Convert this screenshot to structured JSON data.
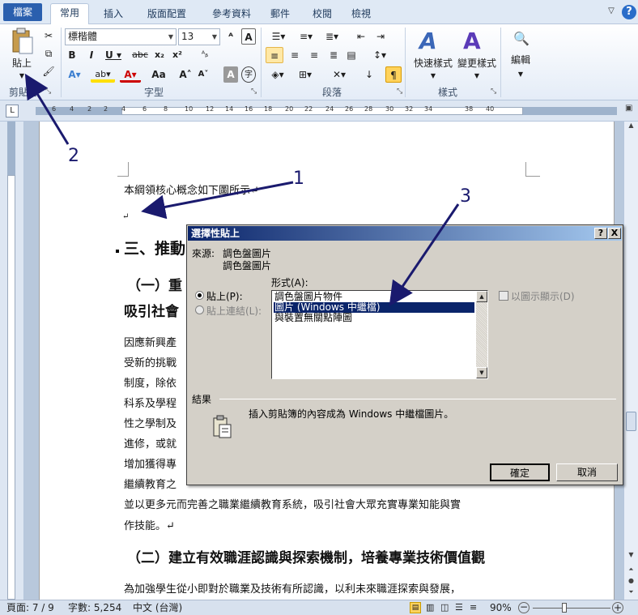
{
  "tabs": [
    {
      "label": "檔案"
    },
    {
      "label": "常用"
    },
    {
      "label": "插入"
    },
    {
      "label": "版面配置"
    },
    {
      "label": "參考資料"
    },
    {
      "label": "郵件"
    },
    {
      "label": "校閱"
    },
    {
      "label": "檢視"
    }
  ],
  "ribbon": {
    "paste_label": "貼上",
    "clipboard_label": "剪貼簿",
    "font_name": "標楷體",
    "font_size": "13",
    "font_group_label": "字型",
    "paragraph_label": "段落",
    "quick_styles_label": "快速樣式",
    "change_styles_label": "變更樣式",
    "styles_group_label": "樣式",
    "editing_label": "編輯"
  },
  "ruler": {
    "ticks": [
      "6",
      "4",
      "2",
      "2",
      "4",
      "6",
      "8",
      "10",
      "12",
      "14",
      "16",
      "18",
      "20",
      "22",
      "24",
      "26",
      "28",
      "30",
      "32",
      "34",
      "38",
      "40"
    ]
  },
  "document": {
    "line1": "本綱領核心概念如下圖所示↵",
    "line2": "↵",
    "h3": "三、推動",
    "h4a": "（一）重",
    "h4a2": "吸引社會",
    "p_lines": [
      "因應新興產",
      "受新的挑戰",
      "制度，除依",
      "科系及學程",
      "性之學制及",
      "進修，或就",
      "增加獲得專",
      "繼續教育之"
    ],
    "p_full1": "並以更多元而完善之職業繼續教育系統，吸引社會大眾充實專業知能與實",
    "p_full2": "作技能。↵",
    "h4b": "（二）建立有效職涯認識與探索機制，培養專業技術價值觀",
    "p_last": "為加強學生從小即對於職業及技術有所認識，以利未來職涯探索與發展，"
  },
  "dialog": {
    "title": "選擇性貼上",
    "help": "?",
    "close": "X",
    "source_label": "來源:",
    "source_value1": "調色盤圖片",
    "source_value2": "調色盤圖片",
    "as_label": "形式(A):",
    "paste_option": "貼上(P):",
    "paste_link_option": "貼上連結(L):",
    "list_items": [
      "調色盤圖片物件",
      "圖片 (Windows 中繼檔)",
      "與裝置無關點陣圖"
    ],
    "display_icon_label": "以圖示顯示(D)",
    "result_label": "結果",
    "result_text": "插入剪貼簿的內容成為 Windows 中繼檔圖片。",
    "ok": "確定",
    "cancel": "取消"
  },
  "callouts": [
    "1",
    "2",
    "3"
  ],
  "status": {
    "page": "頁面: 7 / 9",
    "words": "字數: 5,254",
    "language": "中文 (台灣)",
    "zoom": "90%"
  },
  "colors": {
    "file_tab": "#2a5fae",
    "dialog_title": "#0a246a",
    "arrow": "#1a1a6e"
  }
}
